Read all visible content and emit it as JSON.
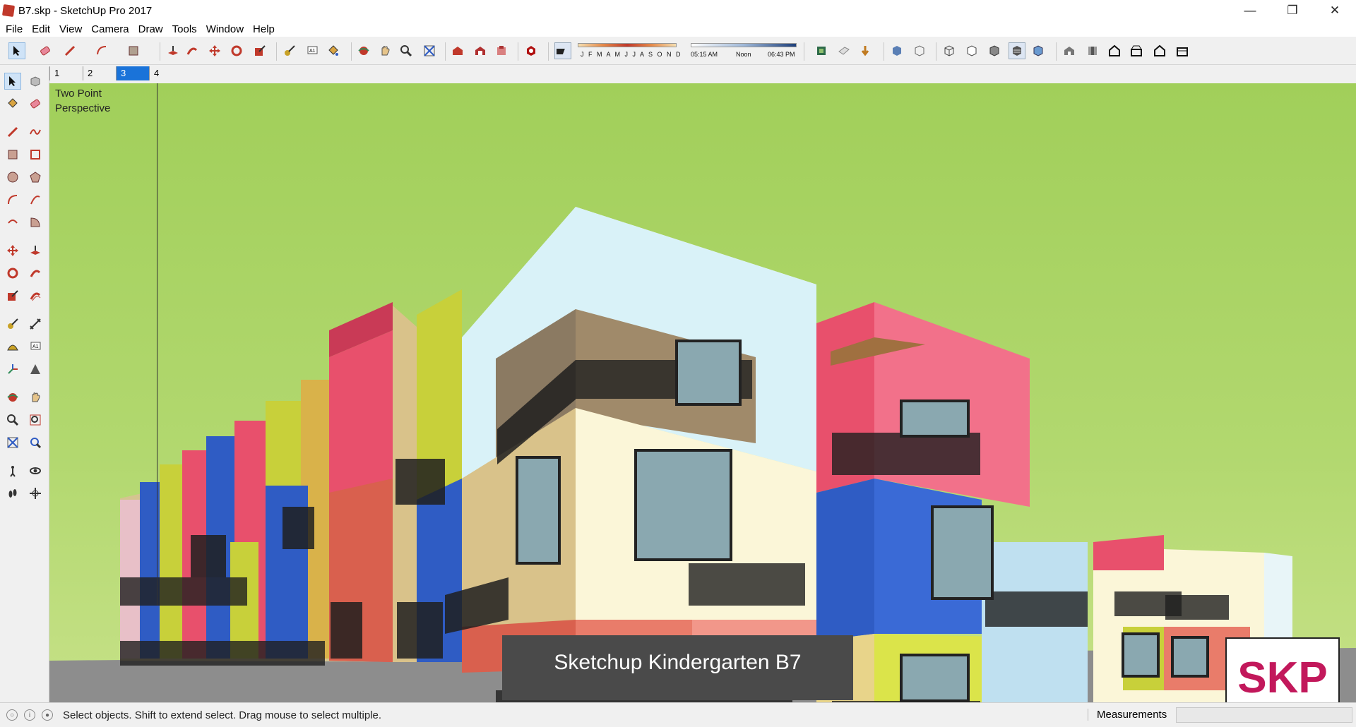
{
  "window": {
    "title": "B7.skp - SketchUp Pro 2017"
  },
  "menu": [
    "File",
    "Edit",
    "View",
    "Camera",
    "Draw",
    "Tools",
    "Window",
    "Help"
  ],
  "shadow_strip": {
    "months": "J F M A M J J A S O N D",
    "time_start": "05:15 AM",
    "time_mid": "Noon",
    "time_end": "06:43 PM"
  },
  "scenes": [
    {
      "label": "1"
    },
    {
      "label": "2"
    },
    {
      "label": "3",
      "active": true
    },
    {
      "label": "4"
    }
  ],
  "viewport": {
    "perspective_line1": "Two Point",
    "perspective_line2": "Perspective",
    "caption": "Sketchup Kindergarten B7",
    "logo_text": "SKP"
  },
  "status": {
    "message": "Select objects. Shift to extend select. Drag mouse to select multiple.",
    "measurements_label": "Measurements",
    "measurements_value": ""
  },
  "colors": {
    "sky_green": "#a1cf5a",
    "pink": "#e8506c",
    "blue": "#2f5cc4",
    "yellow": "#c8d03a",
    "cream": "#fbf6d8",
    "sky_blue": "#d9f2f8",
    "salmon": "#d9604e",
    "logo_magenta": "#c2185b"
  }
}
